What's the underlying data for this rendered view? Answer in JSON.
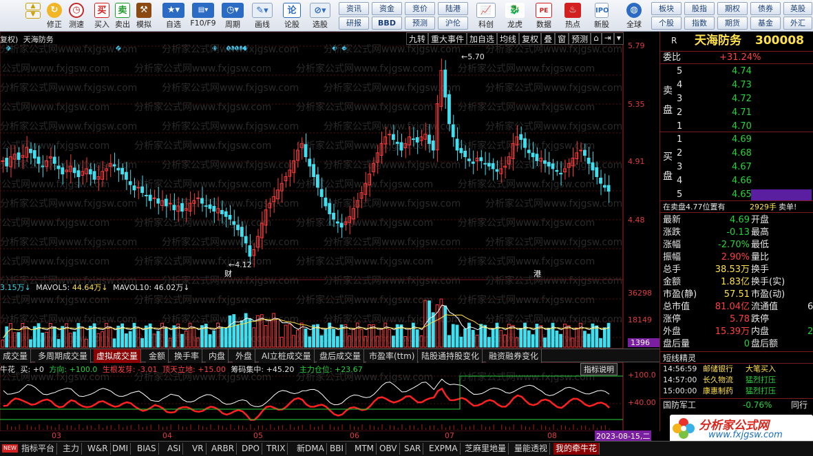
{
  "toolbar": {
    "items": [
      {
        "label": "修正",
        "icon": "up-down-arrows-icon"
      },
      {
        "label": "测速",
        "icon": "clock-icon"
      },
      {
        "label": "买入",
        "icon": "buy-icon",
        "glyph": "买"
      },
      {
        "label": "卖出",
        "icon": "sell-icon",
        "glyph": "卖"
      },
      {
        "label": "模拟",
        "icon": "gavel-icon"
      },
      {
        "label": "自选",
        "icon": "star-icon"
      },
      {
        "label": "F10/F9",
        "icon": "f10-icon"
      },
      {
        "label": "周期",
        "icon": "cycle-icon"
      },
      {
        "label": "画线",
        "icon": "pencil-icon"
      },
      {
        "label": "论股",
        "icon": "forum-icon",
        "glyph": "论"
      },
      {
        "label": "选股",
        "icon": "pick-stock-icon"
      },
      {
        "label": "科创",
        "icon": "chart-icon"
      },
      {
        "label": "龙虎",
        "icon": "dragon-icon"
      },
      {
        "label": "数据",
        "icon": "pe-icon",
        "glyph": "PE"
      },
      {
        "label": "热点",
        "icon": "hot-icon"
      },
      {
        "label": "新股",
        "icon": "ipo-icon"
      },
      {
        "label": "全球",
        "icon": "globe-icon"
      }
    ],
    "small_buttons": [
      "资讯",
      "资金",
      "竞价",
      "陆港",
      "研报",
      "BBD",
      "预测",
      "沪伦",
      "板块",
      "股指",
      "期权",
      "债券",
      "英股",
      "个股",
      "指数",
      "期货",
      "基金",
      "外汇"
    ]
  },
  "chart": {
    "title": "天海防务",
    "title_prefix": "复权)",
    "toolbar_tabs": [
      "九转",
      "重大事件",
      "加自选",
      "均线",
      "复权",
      "叠",
      "窗",
      "预测"
    ],
    "price_axis": [
      "5.79",
      "5.35",
      "4.91",
      "4.48"
    ],
    "high_marker": "5.70",
    "low_marker": "4.12",
    "badges": [
      "财",
      "港"
    ],
    "volume_header": {
      "vol": "3.15万↓",
      "mavol5_label": "MAVOL5:",
      "mavol5": "44.64万↓",
      "mavol10_label": "MAVOL10:",
      "mavol10": "46.02万↓"
    },
    "volume_axis": [
      "36298",
      "18149",
      "1396"
    ],
    "indicator_tabs": [
      "成交量",
      "多周期成交量",
      "虚拟成交量",
      "金额",
      "换手率",
      "内盘",
      "外盘",
      "AI立桩成交量",
      "盘后成交量",
      "市盈率(ttm)",
      "陆股通持股变化",
      "融资融券变化"
    ],
    "indicator_active": "虚拟成交量",
    "niu_header": {
      "name": "牛花",
      "buy": "买: +0",
      "direction": "方向: +100.0",
      "birth": "生根发芽: -3.01",
      "top": "顶天立地: +15.00",
      "chip": "筹码集中: +45.20",
      "main": "主力仓位: +23.67"
    },
    "niu_help": "指标说明",
    "niu_axis": [
      "+100.0",
      "+40.00"
    ],
    "x_axis": [
      "03",
      "04",
      "05",
      "06",
      "07",
      "08"
    ],
    "date_label": "2023-08-15,二",
    "watermark": "分析家公式网www.fxjgsw.com",
    "colors": {
      "up": "#ff3b3b",
      "down": "#40e0f0",
      "ma5": "#ffffff",
      "ma10": "#ffe14a",
      "niu_green": "#2bd43b"
    }
  },
  "quote": {
    "code_flag": "R",
    "name": "天海防务",
    "code": "300008",
    "weibi_label": "委比",
    "weibi": "+31.24%",
    "sell_label": "卖盘",
    "buy_label": "买盘",
    "sells": [
      {
        "level": "5",
        "price": "4.74"
      },
      {
        "level": "4",
        "price": "4.73"
      },
      {
        "level": "3",
        "price": "4.72"
      },
      {
        "level": "2",
        "price": "4.71"
      },
      {
        "level": "1",
        "price": "4.70"
      }
    ],
    "buys": [
      {
        "level": "1",
        "price": "4.69"
      },
      {
        "level": "2",
        "price": "4.68"
      },
      {
        "level": "3",
        "price": "4.67"
      },
      {
        "level": "4",
        "price": "4.66"
      },
      {
        "level": "5",
        "price": "4.65"
      }
    ],
    "ticker_note": "在卖盘4.77位置有",
    "ticker_vol": "2929手",
    "ticker_tag": "卖单!",
    "stats": [
      {
        "k1": "最新",
        "v1": "4.69",
        "k2": "开盘"
      },
      {
        "k1": "涨跌",
        "v1": "-0.13",
        "k2": "最高"
      },
      {
        "k1": "涨幅",
        "v1": "-2.70%",
        "k2": "最低"
      },
      {
        "k1": "振幅",
        "v1": "2.90%",
        "k2": "量比"
      },
      {
        "k1": "总手",
        "v1": "38.53万",
        "k2": "换手"
      },
      {
        "k1": "金额",
        "v1": "1.83亿",
        "k2": "换手(实)"
      },
      {
        "k1": "市盈(静)",
        "v1": "57.51",
        "k2": "市盈(动)"
      },
      {
        "k1": "总市值",
        "v1": "81.04亿",
        "k2": "流通值"
      },
      {
        "k1": "涨停",
        "v1": "5.78",
        "k2": "跌停"
      },
      {
        "k1": "外盘",
        "v1": "15.39万",
        "k2": "内盘"
      },
      {
        "k1": "盘后量",
        "v1": "0",
        "k2": "盘后额"
      }
    ],
    "stats_right_partial": [
      "",
      "",
      "",
      "",
      "",
      "",
      "",
      "6",
      "",
      "2",
      ""
    ],
    "jingling_title": "短线精灵",
    "jingling": [
      {
        "time": "14:56:59",
        "name": "邮储银行",
        "action": "大笔买入"
      },
      {
        "time": "14:57:00",
        "name": "长久物流",
        "action": "猛烈打压"
      },
      {
        "time": "15:00:00",
        "name": "康惠制药",
        "action": "猛烈打压"
      }
    ],
    "sector_name": "国防军工",
    "sector_chg": "-0.76%",
    "sector_right": "同行"
  },
  "bottom_tabs": [
    "指标平台",
    "主力",
    "W&R",
    "DMI",
    "BIAS",
    "ASI",
    "VR",
    "ARBR",
    "DPO",
    "TRIX",
    "新DMA",
    "BBI",
    "MTM",
    "OBV",
    "SAR",
    "EXPMA",
    "芝麻里地量",
    "量能透视",
    "我的牵牛花"
  ],
  "bottom_active": "我的牵牛花",
  "brand": {
    "name": "分析家公式网",
    "url": "www.fxjgsw.com"
  }
}
